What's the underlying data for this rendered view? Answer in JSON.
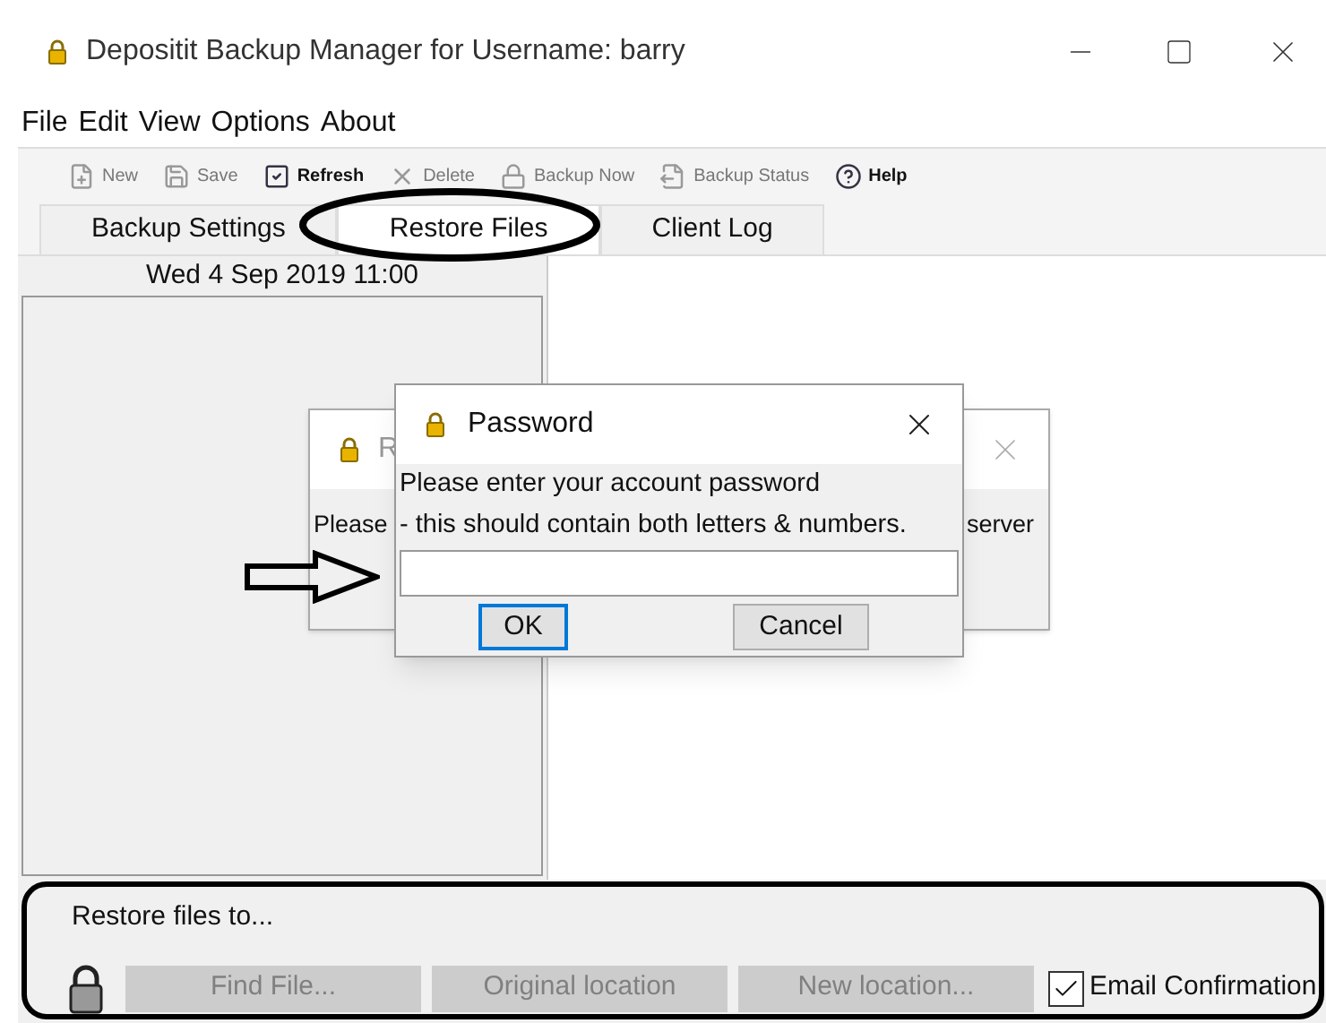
{
  "window": {
    "title": "Depositit Backup Manager for Username: barry"
  },
  "menu": [
    "File",
    "Edit",
    "View",
    "Options",
    "About"
  ],
  "toolbar": [
    {
      "label": "New",
      "disabled": true
    },
    {
      "label": "Save",
      "disabled": true
    },
    {
      "label": "Refresh",
      "disabled": false
    },
    {
      "label": "Delete",
      "disabled": true
    },
    {
      "label": "Backup Now",
      "disabled": true
    },
    {
      "label": "Backup Status",
      "disabled": true
    },
    {
      "label": "Help",
      "disabled": false
    }
  ],
  "tabs": [
    {
      "label": "Backup Settings",
      "selected": false
    },
    {
      "label": "Restore Files",
      "selected": true
    },
    {
      "label": "Client Log",
      "selected": false
    }
  ],
  "backup_list": {
    "header": "Wed 4 Sep 2019 11:00"
  },
  "background_dialog": {
    "title": "R",
    "text_left": "Please",
    "text_right": "server"
  },
  "password_dialog": {
    "title": "Password",
    "message": [
      "Please enter your account password",
      "- this should contain both letters & numbers."
    ],
    "buttons": [
      {
        "label": "OK",
        "focused": true
      },
      {
        "label": "Cancel",
        "focused": false
      }
    ]
  },
  "restore_panel": {
    "label": "Restore files to...",
    "buttons": [
      {
        "label": "Find File...",
        "disabled": true
      },
      {
        "label": "Original location",
        "disabled": true
      },
      {
        "label": "New location...",
        "disabled": true
      }
    ],
    "email_confirmation": {
      "label": "Email Confirmation",
      "checked": true
    }
  }
}
